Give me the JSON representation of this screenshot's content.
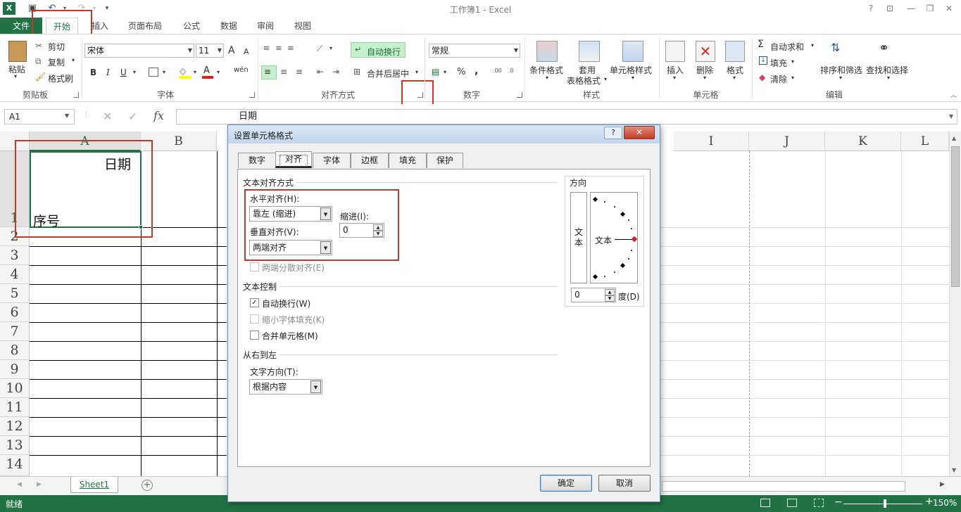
{
  "window": {
    "title": "工作簿1 - Excel",
    "help_label": "?",
    "minimize_label": "—",
    "restore_label": "❐",
    "close_label": "✕"
  },
  "ribbon_tabs": [
    "文件",
    "开始",
    "插入",
    "页面布局",
    "公式",
    "数据",
    "审阅",
    "视图"
  ],
  "clipboard": {
    "paste": "粘贴",
    "cut": "剪切",
    "copy": "复制",
    "format_painter": "格式刷",
    "group": "剪贴板"
  },
  "font": {
    "name": "宋体",
    "size": "11",
    "bold": "B",
    "italic": "I",
    "underline": "U",
    "grow": "A",
    "shrink": "A",
    "phonetic": "wén",
    "group": "字体"
  },
  "alignment": {
    "wrap_text": "自动换行",
    "merge_center": "合并后居中",
    "group": "对齐方式"
  },
  "number": {
    "format": "常规",
    "percent": "%",
    "comma": ",",
    "group": "数字"
  },
  "styles": {
    "conditional": "条件格式",
    "table_line1": "套用",
    "table_line2": "表格格式",
    "cell_styles": "单元格样式",
    "group": "样式"
  },
  "cells": {
    "insert": "插入",
    "delete": "删除",
    "format": "格式",
    "group": "单元格"
  },
  "editing": {
    "autosum": "自动求和",
    "fill": "填充",
    "clear": "清除",
    "sort_filter": "排序和筛选",
    "find_select": "查找和选择",
    "group": "编辑"
  },
  "formula_bar": {
    "name_box": "A1",
    "cancel": "✕",
    "enter": "✓",
    "fx": "fx",
    "content": "日期"
  },
  "columns": [
    "A",
    "B",
    "I",
    "J",
    "K",
    "L"
  ],
  "rows": [
    "1",
    "2",
    "3",
    "4",
    "5",
    "6",
    "7",
    "8",
    "9",
    "10",
    "11",
    "12",
    "13",
    "14"
  ],
  "cell_a1": {
    "top_text": "日期",
    "bottom_text": "序号"
  },
  "sheet_tab": "Sheet1",
  "status": {
    "ready": "就绪",
    "zoom": "150%"
  },
  "dialog": {
    "title": "设置单元格格式",
    "tabs": [
      "数字",
      "对齐",
      "字体",
      "边框",
      "填充",
      "保护"
    ],
    "text_alignment_section": "文本对齐方式",
    "horizontal_label": "水平对齐(H):",
    "horizontal_value": "靠左 (缩进)",
    "indent_label": "缩进(I):",
    "indent_value": "0",
    "vertical_label": "垂直对齐(V):",
    "vertical_value": "两端对齐",
    "justify_distributed": "两端分散对齐(E)",
    "text_control_section": "文本控制",
    "wrap_text": "自动换行(W)",
    "shrink_to_fit": "缩小字体填充(K)",
    "merge_cells": "合并单元格(M)",
    "rtl_section": "从右到左",
    "text_direction_label": "文字方向(T):",
    "text_direction_value": "根据内容",
    "orientation_section": "方向",
    "vertical_text": "文本",
    "horizontal_text": "文本",
    "degrees_value": "0",
    "degrees_label": "度(D)",
    "ok": "确定",
    "cancel": "取消"
  },
  "colors": {
    "excel_green": "#217346",
    "highlight_red": "#c0392b"
  }
}
